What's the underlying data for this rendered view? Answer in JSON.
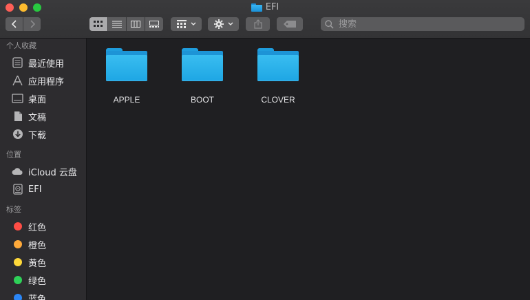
{
  "window": {
    "title": "EFI"
  },
  "toolbar": {
    "search_placeholder": "搜索"
  },
  "sidebar": {
    "favorites": {
      "title": "个人收藏",
      "items": [
        {
          "label": "最近使用",
          "icon": "recents-icon"
        },
        {
          "label": "应用程序",
          "icon": "applications-icon"
        },
        {
          "label": "桌面",
          "icon": "desktop-icon"
        },
        {
          "label": "文稿",
          "icon": "documents-icon"
        },
        {
          "label": "下载",
          "icon": "downloads-icon"
        }
      ]
    },
    "locations": {
      "title": "位置",
      "items": [
        {
          "label": "iCloud 云盘",
          "icon": "icloud-icon"
        },
        {
          "label": "EFI",
          "icon": "disk-icon"
        }
      ]
    },
    "tags": {
      "title": "标签",
      "items": [
        {
          "label": "红色",
          "color": "#fe4d45"
        },
        {
          "label": "橙色",
          "color": "#fea93a"
        },
        {
          "label": "黄色",
          "color": "#fed83a"
        },
        {
          "label": "绿色",
          "color": "#2ed158"
        },
        {
          "label": "蓝色",
          "color": "#2b86f6"
        }
      ]
    }
  },
  "content": {
    "files": [
      {
        "name": "APPLE",
        "icon": "folder-icon"
      },
      {
        "name": "BOOT",
        "icon": "folder-icon"
      },
      {
        "name": "CLOVER",
        "icon": "folder-icon"
      }
    ]
  },
  "colors": {
    "accent_folder": "#1ea6e4",
    "sidebar_bg": "#2d2c2f",
    "content_bg": "#1f1f22"
  }
}
